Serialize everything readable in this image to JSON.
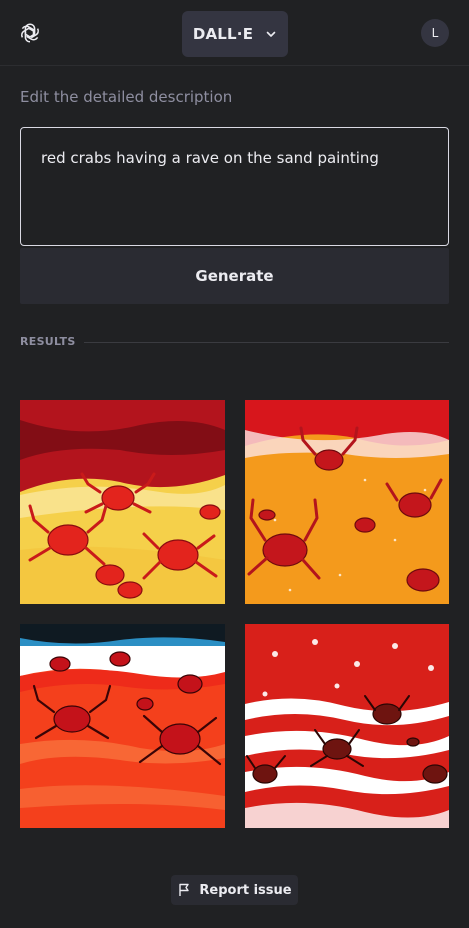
{
  "header": {
    "model_label": "DALL·E",
    "avatar_initial": "L"
  },
  "editor": {
    "helper_text": "Edit the detailed description",
    "prompt_value": "red crabs having a rave on the sand painting",
    "generate_label": "Generate"
  },
  "results": {
    "heading": "RESULTS",
    "images": [
      {
        "name": "result-image-1"
      },
      {
        "name": "result-image-2"
      },
      {
        "name": "result-image-3"
      },
      {
        "name": "result-image-4"
      }
    ]
  },
  "footer": {
    "report_label": "Report issue"
  },
  "colors": {
    "background": "#202123",
    "surface": "#343541",
    "accent_crab": "#d81e1e"
  }
}
